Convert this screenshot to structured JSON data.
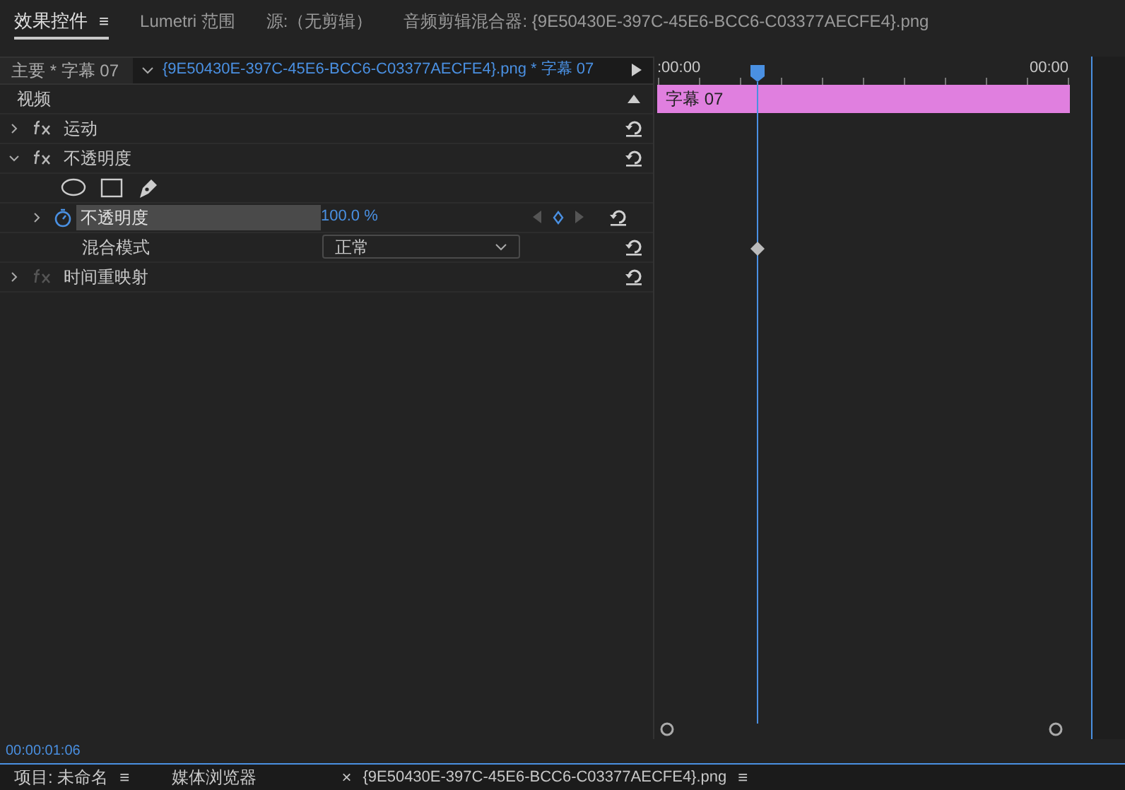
{
  "tabs": [
    {
      "label": "效果控件",
      "selected": true,
      "menu": "≡"
    },
    {
      "label": "Lumetri 范围",
      "selected": false
    },
    {
      "label": "源:（无剪辑）",
      "selected": false
    },
    {
      "label": "音频剪辑混合器: {9E50430E-397C-45E6-BCC6-C03377AECFE4}.png",
      "selected": false
    }
  ],
  "header": {
    "master": "主要 * 字幕 07",
    "clip": "{9E50430E-397C-45E6-BCC6-C03377AECFE4}.png * 字幕 07"
  },
  "timeline": {
    "start": ":00:00",
    "end": "00:00",
    "clip_label": "字幕 07"
  },
  "rows": [
    {
      "kind": "section",
      "label": "视频"
    },
    {
      "kind": "effect",
      "label": "运动",
      "expanded": false,
      "enabled": true
    },
    {
      "kind": "effect",
      "label": "不透明度",
      "expanded": true,
      "enabled": true
    },
    {
      "kind": "masks"
    },
    {
      "kind": "property",
      "label": "不透明度",
      "value": "100.0 %",
      "expanded": false,
      "highlighted": true,
      "keyframe": true
    },
    {
      "kind": "dropdown",
      "label": "混合模式",
      "value": "正常"
    },
    {
      "kind": "effect",
      "label": "时间重映射",
      "expanded": false,
      "enabled": false
    }
  ],
  "timecode": "00:00:01:06",
  "bottom_tabs": [
    {
      "label": "项目: 未命名",
      "menu": "≡"
    },
    {
      "label": "媒体浏览器"
    },
    {
      "label": "{9E50430E-397C-45E6-BCC6-C03377AECFE4}.png",
      "menu": "≡",
      "close": "×"
    }
  ]
}
